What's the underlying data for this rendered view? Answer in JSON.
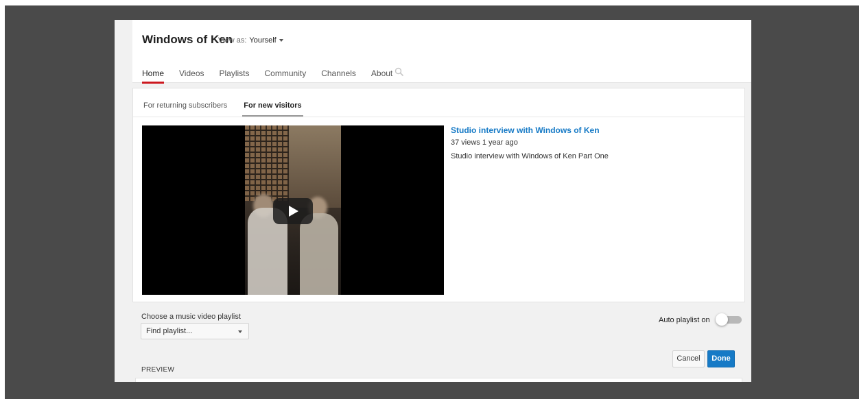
{
  "header": {
    "channel_title": "Windows of Ken",
    "view_as_label": "View as:",
    "view_as_value": "Yourself",
    "nav_tabs": [
      {
        "label": "Home",
        "active": true
      },
      {
        "label": "Videos",
        "active": false
      },
      {
        "label": "Playlists",
        "active": false
      },
      {
        "label": "Community",
        "active": false
      },
      {
        "label": "Channels",
        "active": false
      },
      {
        "label": "About",
        "active": false
      }
    ]
  },
  "trailer": {
    "subtabs": [
      {
        "label": "For returning subscribers",
        "active": false
      },
      {
        "label": "For new visitors",
        "active": true
      }
    ],
    "video": {
      "title": "Studio interview with Windows of Ken",
      "meta": "37 views  1 year ago",
      "description": "Studio interview with Windows of Ken Part One"
    }
  },
  "playlist": {
    "label": "Choose a music video playlist",
    "selected": "Find playlist...",
    "auto_label": "Auto playlist on",
    "auto_on": false
  },
  "actions": {
    "cancel": "Cancel",
    "done": "Done"
  },
  "preview": {
    "label": "PREVIEW"
  },
  "colors": {
    "accent_red": "#cc181e",
    "link_blue": "#167ac6",
    "backdrop": "#4a4a4a"
  }
}
